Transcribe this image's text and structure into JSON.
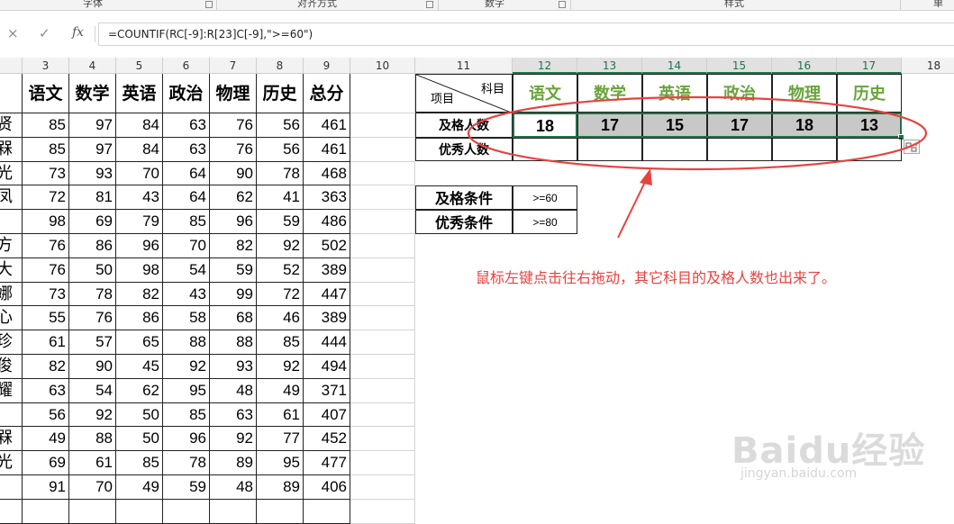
{
  "ribbon": {
    "groups": [
      "字体",
      "对齐方式",
      "数字",
      "样式",
      "单"
    ]
  },
  "formula_bar": {
    "cancel_icon": "×",
    "enter_icon": "✓",
    "fx_label": "fx",
    "formula": "=COUNTIF(RC[-9]:R[23]C[-9],\">=60\")"
  },
  "columns": [
    "3",
    "4",
    "5",
    "6",
    "7",
    "8",
    "9",
    "10",
    "11",
    "12",
    "13",
    "14",
    "15",
    "16",
    "17",
    "18"
  ],
  "score_table": {
    "headers": [
      "语文",
      "数学",
      "英语",
      "政治",
      "物理",
      "历史",
      "总分"
    ],
    "name_fragments": [
      "",
      "贤",
      "槑",
      "光",
      "凤",
      "",
      "方",
      "大",
      "娜",
      "心",
      "珍",
      "俊",
      "耀",
      "",
      "槑",
      "光",
      "",
      ""
    ],
    "rows": [
      [
        "85",
        "97",
        "84",
        "63",
        "76",
        "56",
        "461"
      ],
      [
        "85",
        "97",
        "84",
        "63",
        "76",
        "56",
        "461"
      ],
      [
        "73",
        "93",
        "70",
        "64",
        "90",
        "78",
        "468"
      ],
      [
        "72",
        "81",
        "43",
        "64",
        "62",
        "41",
        "363"
      ],
      [
        "98",
        "69",
        "79",
        "85",
        "96",
        "59",
        "486"
      ],
      [
        "76",
        "86",
        "96",
        "70",
        "82",
        "92",
        "502"
      ],
      [
        "76",
        "50",
        "98",
        "54",
        "59",
        "52",
        "389"
      ],
      [
        "73",
        "78",
        "82",
        "43",
        "99",
        "72",
        "447"
      ],
      [
        "55",
        "76",
        "86",
        "58",
        "68",
        "46",
        "389"
      ],
      [
        "61",
        "57",
        "65",
        "88",
        "88",
        "85",
        "444"
      ],
      [
        "82",
        "90",
        "45",
        "92",
        "93",
        "92",
        "494"
      ],
      [
        "63",
        "54",
        "62",
        "95",
        "48",
        "49",
        "371"
      ],
      [
        "56",
        "92",
        "50",
        "85",
        "63",
        "61",
        "407"
      ],
      [
        "49",
        "88",
        "50",
        "96",
        "92",
        "77",
        "452"
      ],
      [
        "69",
        "61",
        "85",
        "78",
        "89",
        "95",
        "477"
      ],
      [
        "91",
        "70",
        "49",
        "59",
        "48",
        "89",
        "406"
      ]
    ]
  },
  "stats_table": {
    "corner_subject": "科目",
    "corner_item": "项目",
    "subjects": [
      "语文",
      "数学",
      "英语",
      "政治",
      "物理",
      "历史"
    ],
    "pass_label": "及格人数",
    "pass_counts": [
      "18",
      "17",
      "15",
      "17",
      "18",
      "13"
    ],
    "excellent_label": "优秀人数",
    "excellent_counts": [
      "",
      "",
      "",
      "",
      "",
      ""
    ]
  },
  "conditions": {
    "pass_label": "及格条件",
    "pass_value": ">=60",
    "excellent_label": "优秀条件",
    "excellent_value": ">=80"
  },
  "annotation": {
    "text": "鼠标左键点击往右拖动，其它科目的及格人数也出来了。",
    "color": "#e8423f"
  },
  "watermark": {
    "brand": "Baidu经验",
    "url": "jingyan.baidu.com"
  },
  "colors": {
    "subject_green": "#6aa33b",
    "selection_green": "#217346",
    "selected_fill": "#c8c8c8"
  }
}
